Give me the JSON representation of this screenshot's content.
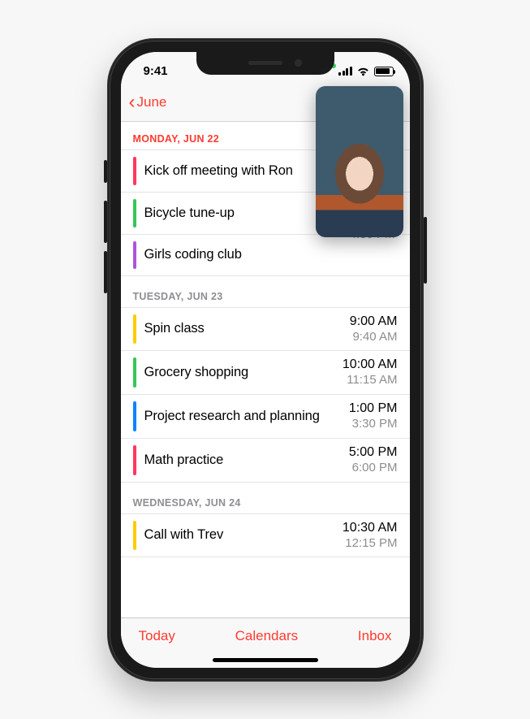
{
  "status": {
    "time": "9:41"
  },
  "nav": {
    "back_label": "June"
  },
  "sections": [
    {
      "header": "MONDAY, JUN 22",
      "events": [
        {
          "title": "Kick off meeting with Ron",
          "color": "#ff375f",
          "start": "",
          "end": ""
        },
        {
          "title": "Bicycle tune-up",
          "color": "#34c759",
          "start": "",
          "end": ""
        },
        {
          "title": "Girls coding club",
          "color": "#af52de",
          "start": "",
          "end": ""
        }
      ]
    },
    {
      "header": "TUESDAY, JUN 23",
      "events": [
        {
          "title": "Spin class",
          "color": "#ffcc00",
          "start": "9:00 AM",
          "end": "9:40 AM"
        },
        {
          "title": "Grocery shopping",
          "color": "#34c759",
          "start": "10:00 AM",
          "end": "11:15 AM"
        },
        {
          "title": "Project research and planning",
          "color": "#0a84ff",
          "start": "1:00 PM",
          "end": "3:30 PM"
        },
        {
          "title": "Math practice",
          "color": "#ff375f",
          "start": "5:00 PM",
          "end": "6:00 PM"
        }
      ]
    },
    {
      "header": "WEDNESDAY, JUN 24",
      "events": [
        {
          "title": "Call with Trev",
          "color": "#ffcc00",
          "start": "10:30 AM",
          "end": "12:15 PM"
        }
      ]
    }
  ],
  "peek_time": "4:30 PM",
  "toolbar": {
    "today": "Today",
    "calendars": "Calendars",
    "inbox": "Inbox"
  },
  "colors": {
    "accent": "#ff3b30"
  }
}
